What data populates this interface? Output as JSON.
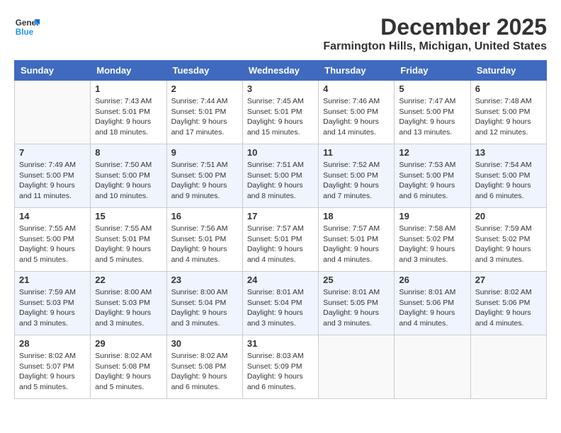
{
  "logo": {
    "line1": "General",
    "line2": "Blue"
  },
  "title": "December 2025",
  "location": "Farmington Hills, Michigan, United States",
  "days_of_week": [
    "Sunday",
    "Monday",
    "Tuesday",
    "Wednesday",
    "Thursday",
    "Friday",
    "Saturday"
  ],
  "weeks": [
    [
      {
        "day": "",
        "info": ""
      },
      {
        "day": "1",
        "info": "Sunrise: 7:43 AM\nSunset: 5:01 PM\nDaylight: 9 hours\nand 18 minutes."
      },
      {
        "day": "2",
        "info": "Sunrise: 7:44 AM\nSunset: 5:01 PM\nDaylight: 9 hours\nand 17 minutes."
      },
      {
        "day": "3",
        "info": "Sunrise: 7:45 AM\nSunset: 5:01 PM\nDaylight: 9 hours\nand 15 minutes."
      },
      {
        "day": "4",
        "info": "Sunrise: 7:46 AM\nSunset: 5:00 PM\nDaylight: 9 hours\nand 14 minutes."
      },
      {
        "day": "5",
        "info": "Sunrise: 7:47 AM\nSunset: 5:00 PM\nDaylight: 9 hours\nand 13 minutes."
      },
      {
        "day": "6",
        "info": "Sunrise: 7:48 AM\nSunset: 5:00 PM\nDaylight: 9 hours\nand 12 minutes."
      }
    ],
    [
      {
        "day": "7",
        "info": "Sunrise: 7:49 AM\nSunset: 5:00 PM\nDaylight: 9 hours\nand 11 minutes."
      },
      {
        "day": "8",
        "info": "Sunrise: 7:50 AM\nSunset: 5:00 PM\nDaylight: 9 hours\nand 10 minutes."
      },
      {
        "day": "9",
        "info": "Sunrise: 7:51 AM\nSunset: 5:00 PM\nDaylight: 9 hours\nand 9 minutes."
      },
      {
        "day": "10",
        "info": "Sunrise: 7:51 AM\nSunset: 5:00 PM\nDaylight: 9 hours\nand 8 minutes."
      },
      {
        "day": "11",
        "info": "Sunrise: 7:52 AM\nSunset: 5:00 PM\nDaylight: 9 hours\nand 7 minutes."
      },
      {
        "day": "12",
        "info": "Sunrise: 7:53 AM\nSunset: 5:00 PM\nDaylight: 9 hours\nand 6 minutes."
      },
      {
        "day": "13",
        "info": "Sunrise: 7:54 AM\nSunset: 5:00 PM\nDaylight: 9 hours\nand 6 minutes."
      }
    ],
    [
      {
        "day": "14",
        "info": "Sunrise: 7:55 AM\nSunset: 5:00 PM\nDaylight: 9 hours\nand 5 minutes."
      },
      {
        "day": "15",
        "info": "Sunrise: 7:55 AM\nSunset: 5:01 PM\nDaylight: 9 hours\nand 5 minutes."
      },
      {
        "day": "16",
        "info": "Sunrise: 7:56 AM\nSunset: 5:01 PM\nDaylight: 9 hours\nand 4 minutes."
      },
      {
        "day": "17",
        "info": "Sunrise: 7:57 AM\nSunset: 5:01 PM\nDaylight: 9 hours\nand 4 minutes."
      },
      {
        "day": "18",
        "info": "Sunrise: 7:57 AM\nSunset: 5:01 PM\nDaylight: 9 hours\nand 4 minutes."
      },
      {
        "day": "19",
        "info": "Sunrise: 7:58 AM\nSunset: 5:02 PM\nDaylight: 9 hours\nand 3 minutes."
      },
      {
        "day": "20",
        "info": "Sunrise: 7:59 AM\nSunset: 5:02 PM\nDaylight: 9 hours\nand 3 minutes."
      }
    ],
    [
      {
        "day": "21",
        "info": "Sunrise: 7:59 AM\nSunset: 5:03 PM\nDaylight: 9 hours\nand 3 minutes."
      },
      {
        "day": "22",
        "info": "Sunrise: 8:00 AM\nSunset: 5:03 PM\nDaylight: 9 hours\nand 3 minutes."
      },
      {
        "day": "23",
        "info": "Sunrise: 8:00 AM\nSunset: 5:04 PM\nDaylight: 9 hours\nand 3 minutes."
      },
      {
        "day": "24",
        "info": "Sunrise: 8:01 AM\nSunset: 5:04 PM\nDaylight: 9 hours\nand 3 minutes."
      },
      {
        "day": "25",
        "info": "Sunrise: 8:01 AM\nSunset: 5:05 PM\nDaylight: 9 hours\nand 3 minutes."
      },
      {
        "day": "26",
        "info": "Sunrise: 8:01 AM\nSunset: 5:06 PM\nDaylight: 9 hours\nand 4 minutes."
      },
      {
        "day": "27",
        "info": "Sunrise: 8:02 AM\nSunset: 5:06 PM\nDaylight: 9 hours\nand 4 minutes."
      }
    ],
    [
      {
        "day": "28",
        "info": "Sunrise: 8:02 AM\nSunset: 5:07 PM\nDaylight: 9 hours\nand 5 minutes."
      },
      {
        "day": "29",
        "info": "Sunrise: 8:02 AM\nSunset: 5:08 PM\nDaylight: 9 hours\nand 5 minutes."
      },
      {
        "day": "30",
        "info": "Sunrise: 8:02 AM\nSunset: 5:08 PM\nDaylight: 9 hours\nand 6 minutes."
      },
      {
        "day": "31",
        "info": "Sunrise: 8:03 AM\nSunset: 5:09 PM\nDaylight: 9 hours\nand 6 minutes."
      },
      {
        "day": "",
        "info": ""
      },
      {
        "day": "",
        "info": ""
      },
      {
        "day": "",
        "info": ""
      }
    ]
  ]
}
